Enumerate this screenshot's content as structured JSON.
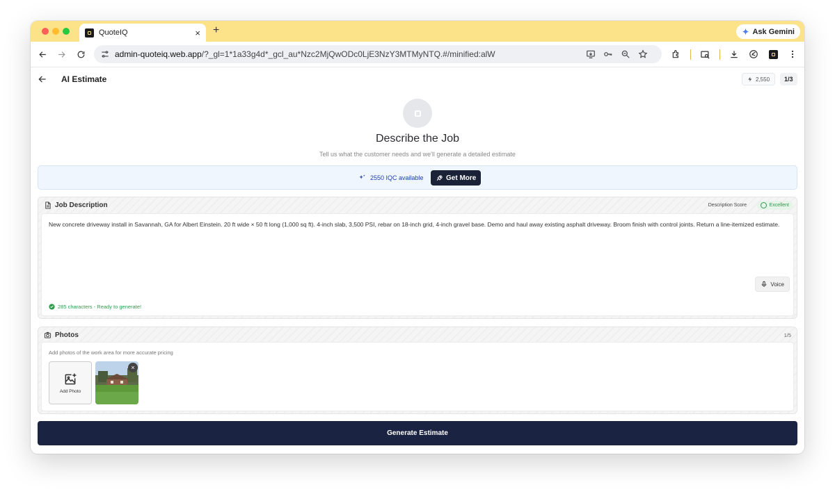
{
  "browser": {
    "tab_title": "QuoteIQ",
    "tab_close": "×",
    "new_tab": "+",
    "ask_gemini": "Ask Gemini",
    "url_host": "admin-quoteiq.web.app",
    "url_rest": "/?_gl=1*1a33g4d*_gcl_au*Nzc2MjQwODc0LjE3NzY3MTMyNTQ.#/minified:alW"
  },
  "app": {
    "title": "AI Estimate",
    "credits": "2,550",
    "page_indicator": "1/3"
  },
  "hero": {
    "title": "Describe the Job",
    "subtitle": "Tell us what the customer needs and we'll generate a detailed estimate"
  },
  "banner": {
    "available": "2550 IQC available",
    "get_more": "Get More"
  },
  "job_description": {
    "heading": "Job Description",
    "score_label": "Description Score",
    "score_value": "Excellent",
    "text": "New concrete driveway install in Savannah, GA for Albert Einstein. 20 ft wide × 50 ft long (1,000 sq ft). 4-inch slab, 3,500 PSI, rebar on 18-inch grid, 4-inch gravel base. Demo and haul away existing asphalt driveway. Broom finish with control joints. Return a line-itemized estimate.",
    "voice_label": "Voice",
    "status": "285 characters - Ready to generate!"
  },
  "photos": {
    "heading": "Photos",
    "count": "1/5",
    "hint": "Add photos of the work area for more accurate pricing",
    "add_label": "Add Photo",
    "remove": "×"
  },
  "generate_label": "Generate Estimate",
  "colors": {
    "tab_strip": "#fce38a",
    "primary_dark": "#1a2442",
    "success": "#2e9b4d",
    "banner_bg": "#f0f6fd",
    "link_blue": "#1e40af"
  }
}
